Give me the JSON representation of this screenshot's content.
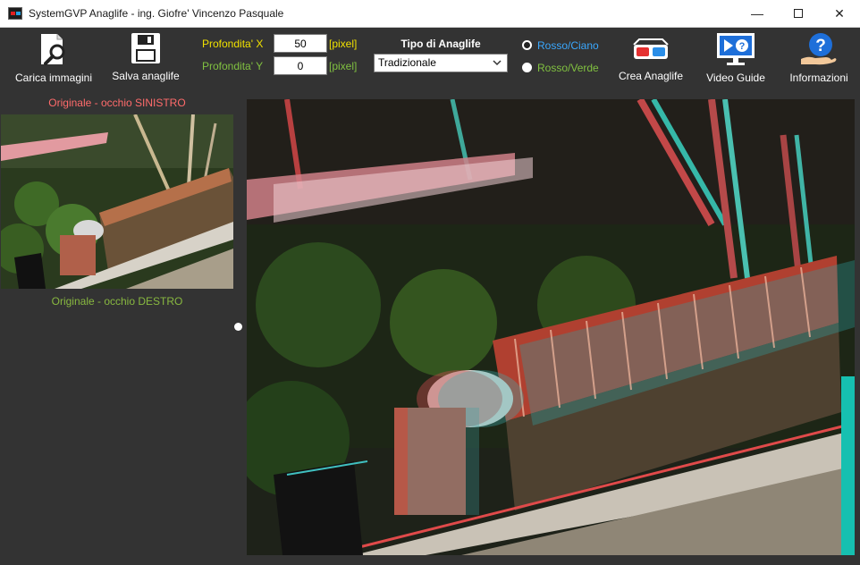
{
  "window": {
    "title": "SystemGVP Anaglife - ing. Giofre' Vincenzo Pasquale",
    "minimize_glyph": "—",
    "close_glyph": "✕"
  },
  "toolbar": {
    "load_label": "Carica immagini",
    "save_label": "Salva anaglife",
    "create_label": "Crea Anaglife",
    "video_label": "Video Guide",
    "info_label": "Informazioni"
  },
  "depth": {
    "x_label": "Profondita' X",
    "x_value": "50",
    "x_unit": "[pixel]",
    "y_label": "Profondita' Y",
    "y_value": "0",
    "y_unit": "[pixel]"
  },
  "anaglyph_type": {
    "title": "Tipo di Anaglife",
    "selected": "Tradizionale"
  },
  "color_mode": {
    "options": [
      "Rosso/Ciano",
      "Rosso/Verde"
    ],
    "selected": "Rosso/Ciano"
  },
  "left_panel": {
    "left_eye_label": "Originale - occhio SINISTRO",
    "right_eye_label": "Originale - occhio DESTRO"
  },
  "icons": {
    "load": "magnifier-document-icon",
    "save": "floppy-disk-icon",
    "create": "3d-glasses-icon",
    "video": "monitor-play-icon",
    "info": "question-hand-icon"
  },
  "colors": {
    "background": "#333333",
    "depth_x": "#f0e000",
    "depth_y": "#80c040",
    "rosso_ciano": "#3aa8ff",
    "left_eye": "#ff6b6b",
    "right_eye": "#88b840"
  }
}
